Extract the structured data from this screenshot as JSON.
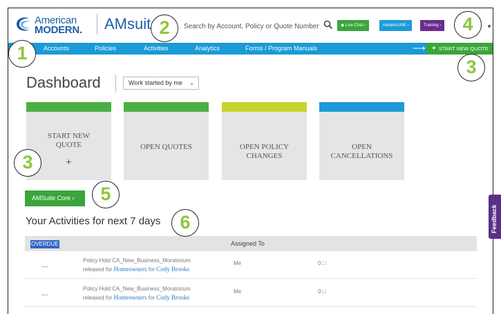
{
  "header": {
    "logo_line1": "American",
    "logo_line2": "MODERN.",
    "app_title": "AMsuite",
    "search_placeholder": "Search by Account, Policy or Quote Number",
    "live_chat": "Live Chat",
    "modernlink": "modernLINK",
    "training": "Training"
  },
  "nav": {
    "items": [
      "Accounts",
      "Policies",
      "Activities",
      "Analytics",
      "Forms / Program Manuals"
    ],
    "start_new_quote": "START NEW QUOTE"
  },
  "dashboard": {
    "title": "Dashboard",
    "filter_value": "Work started by me"
  },
  "tiles": [
    {
      "line1": "START NEW",
      "line2": "QUOTE",
      "plus": "+",
      "color": "#4caf45"
    },
    {
      "line1": "OPEN QUOTES",
      "color": "#4caf45"
    },
    {
      "line1": "OPEN POLICY",
      "line2": "CHANGES",
      "color": "#c7d42c"
    },
    {
      "line1": "OPEN",
      "line2": "CANCELLATIONS",
      "color": "#1e9ad6"
    }
  ],
  "core_button": "AMSuite Core",
  "activities": {
    "title": "Your Activities for next 7 days",
    "overdue_label": "OVERDUE",
    "assigned_header": "Assigned To",
    "rows": [
      {
        "dash": "—",
        "desc_line1": "Policy Hold CA_New_Business_Moratorium",
        "released_for": "released for",
        "link1": "Homeowners",
        "for": "for",
        "link2": "Cody Brooks",
        "assigned": "Me",
        "count": "0"
      },
      {
        "dash": "—",
        "desc_line1": "Policy Hold CA_New_Business_Moratorium",
        "released_for": "released for",
        "link1": "Homeowners",
        "for": "for",
        "link2": "Cody Brooks",
        "assigned": "Me",
        "count": "0"
      }
    ]
  },
  "feedback": "Feedback",
  "markers": [
    "1",
    "2",
    "3",
    "4",
    "3",
    "5",
    "6"
  ]
}
